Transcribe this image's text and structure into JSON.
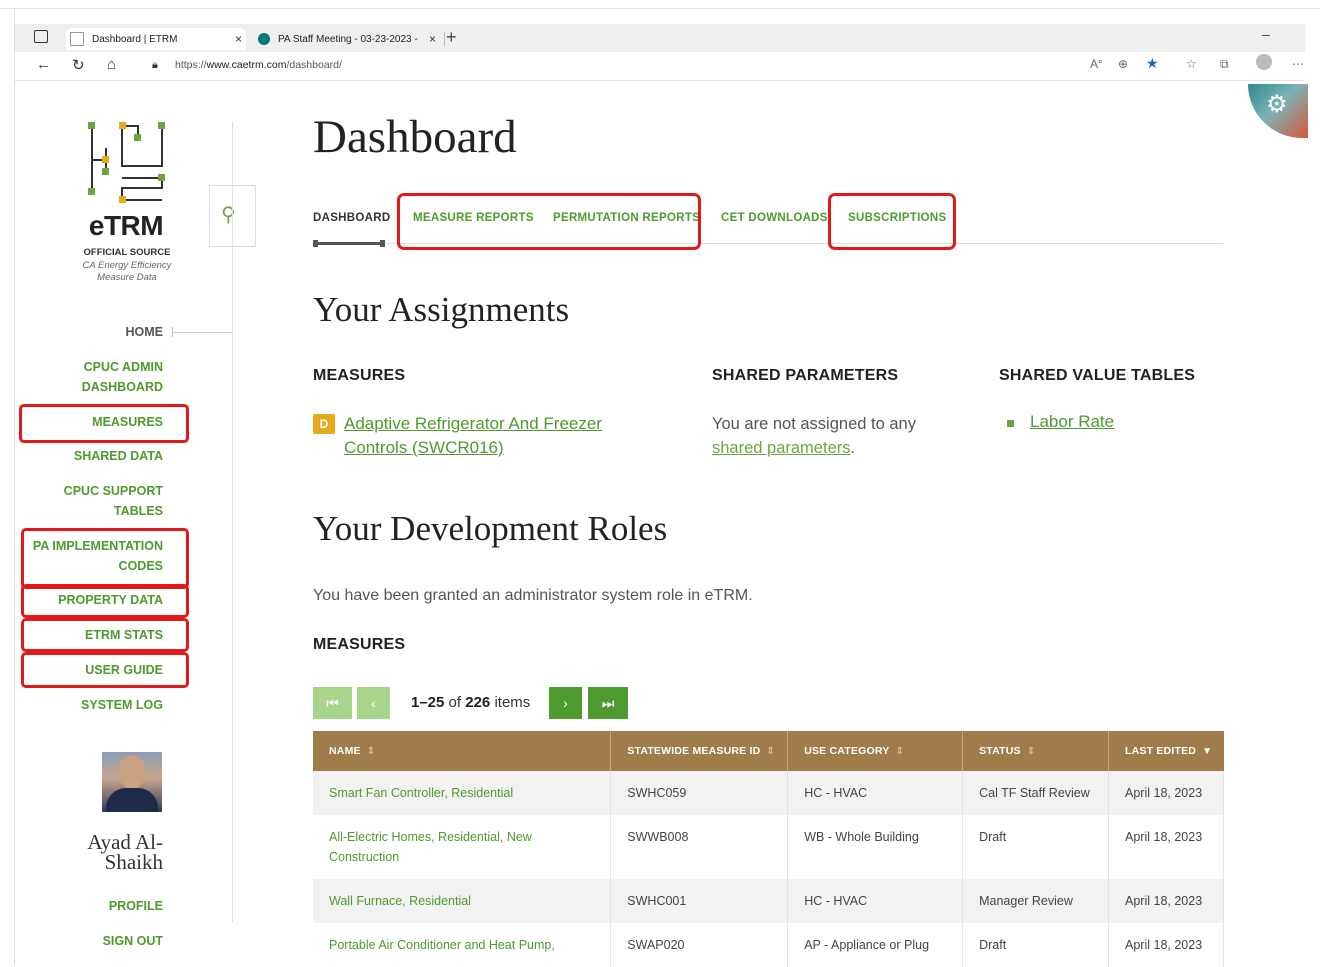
{
  "browser": {
    "tabs": [
      {
        "title": "Dashboard | ETRM",
        "close": "×"
      },
      {
        "title": "PA Staff Meeting - 03-23-2023 -",
        "close": "×"
      }
    ],
    "new_tab": "+",
    "minimize": "–",
    "url_prefix": "https://",
    "url_host": "www.caetrm.com",
    "url_path": "/dashboard/"
  },
  "sidebar": {
    "brand": "eTRM",
    "brand_sub1": "OFFICIAL SOURCE",
    "brand_sub2": "CA Energy Efficiency Measure Data",
    "items": {
      "home": "HOME",
      "cpuc_admin_1": "CPUC ADMIN",
      "cpuc_admin_2": "DASHBOARD",
      "measures": "MEASURES",
      "shared_data": "SHARED DATA",
      "cpuc_support_1": "CPUC SUPPORT",
      "cpuc_support_2": "TABLES",
      "pa_impl_1": "PA IMPLEMENTATION",
      "pa_impl_2": "CODES",
      "property_data": "PROPERTY DATA",
      "etrm_stats": "ETRM STATS",
      "user_guide": "USER GUIDE",
      "system_log": "SYSTEM LOG"
    },
    "user_name_1": "Ayad Al-",
    "user_name_2": "Shaikh",
    "profile": "PROFILE",
    "sign_out": "SIGN OUT"
  },
  "main": {
    "title": "Dashboard",
    "tabs": {
      "dashboard": "DASHBOARD",
      "measure_reports": "MEASURE REPORTS",
      "permutation_reports": "PERMUTATION REPORTS",
      "cet_downloads": "CET DOWNLOADS",
      "subscriptions": "SUBSCRIPTIONS"
    },
    "assignments_title": "Your Assignments",
    "measures_heading": "MEASURES",
    "measure_badge": "D",
    "measure_link": "Adaptive Refrigerator And Freezer Controls (SWCR016)",
    "shared_params_heading": "SHARED PARAMETERS",
    "shared_params_text": "You are not assigned to any",
    "shared_params_link": "shared parameters",
    "shared_params_end": ".",
    "svt_heading": "SHARED VALUE TABLES",
    "svt_link": "Labor Rate",
    "roles_title": "Your Development Roles",
    "roles_text": "You have been granted an administrator system role in eTRM.",
    "roles_measures_heading": "MEASURES",
    "pagination": {
      "first": "⏮",
      "prev": "‹",
      "next": "›",
      "last": "⏭",
      "range": "1–25",
      "of": "of",
      "total": "226",
      "items": "items"
    }
  },
  "table": {
    "columns": [
      "NAME",
      "STATEWIDE MEASURE ID",
      "USE CATEGORY",
      "STATUS",
      "LAST EDITED"
    ],
    "sort_icon": "⇕",
    "sort_active": "▼",
    "rows": [
      {
        "name": "Smart Fan Controller, Residential",
        "id": "SWHC059",
        "category": "HC - HVAC",
        "status": "Cal TF Staff Review",
        "edited": "April 18, 2023"
      },
      {
        "name": "All-Electric Homes, Residential, New Construction",
        "id": "SWWB008",
        "category": "WB - Whole Building",
        "status": "Draft",
        "edited": "April 18, 2023"
      },
      {
        "name": "Wall Furnace, Residential",
        "id": "SWHC001",
        "category": "HC - HVAC",
        "status": "Manager Review",
        "edited": "April 18, 2023"
      },
      {
        "name": "Portable Air Conditioner and Heat Pump,",
        "id": "SWAP020",
        "category": "AP - Appliance or Plug",
        "status": "Draft",
        "edited": "April 18, 2023"
      }
    ]
  },
  "colors": {
    "accent_green": "#4e9a2e",
    "table_header": "#a07b4c",
    "highlight_red": "#e31818"
  }
}
